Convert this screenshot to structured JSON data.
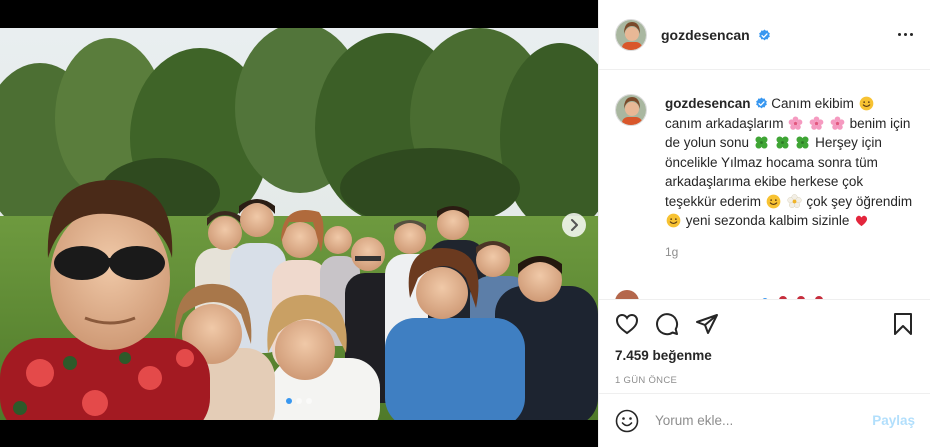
{
  "post": {
    "username": "gozdesencan",
    "verified": true,
    "caption_parts": [
      "Canım ekibim",
      "canım arkadaşlarım",
      "benim için de yolun sonu",
      "Herşey için öncelikle Yılmaz hocama sonra tüm arkadaşlarıma ekibe herkese çok teşekkür ederim",
      "çok şey öğrendim",
      "yeni sezonda kalbim sizinle"
    ],
    "caption_emojis": [
      "smiling-face",
      "cherry-blossom",
      "four-leaf-clover",
      "smiling-face",
      "blossom",
      "smiling-face",
      "red-heart"
    ],
    "caption_age": "1g",
    "likes": "7.459 beğenme",
    "timestamp": "1 GÜN ÖNCE",
    "carousel": {
      "slide_count": 3,
      "active_slide": 1
    }
  },
  "comment_box": {
    "placeholder": "Yorum ekle...",
    "post_label": "Paylaş"
  },
  "colors": {
    "accent": "#3897f0",
    "post_button_disabled": "#b2dffc",
    "text": "#262626",
    "muted": "#8e8e8e",
    "like_heart": "#ed4956"
  }
}
